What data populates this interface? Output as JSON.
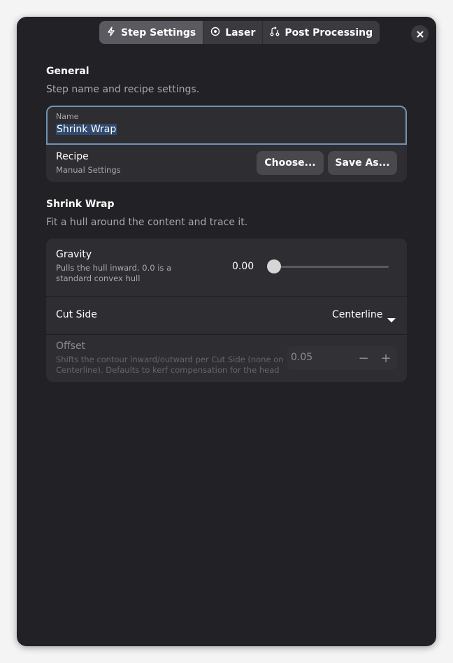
{
  "tabs": [
    {
      "label": "Step Settings",
      "icon": "lightning-icon",
      "active": true
    },
    {
      "label": "Laser",
      "icon": "laser-icon",
      "active": false
    },
    {
      "label": "Post Processing",
      "icon": "post-processing-icon",
      "active": false
    }
  ],
  "general": {
    "title": "General",
    "subtitle": "Step name and recipe settings.",
    "name_label": "Name",
    "name_value": "Shrink Wrap",
    "recipe_title": "Recipe",
    "recipe_value": "Manual Settings",
    "choose_label": "Choose...",
    "save_as_label": "Save As..."
  },
  "shrink_wrap": {
    "title": "Shrink Wrap",
    "subtitle": "Fit a hull around the content and trace it.",
    "gravity_title": "Gravity",
    "gravity_desc_1": "Pulls the hull inward. 0.0 is a",
    "gravity_desc_2": "standard convex hull",
    "gravity_value": "0.00",
    "gravity_fraction": 0.0,
    "cut_side_title": "Cut Side",
    "cut_side_value": "Centerline",
    "offset_title": "Offset",
    "offset_desc_1": "Shifts the contour inward/outward per Cut Side (none on",
    "offset_desc_2": "Centerline). Defaults to kerf compensation for the head",
    "offset_value": "0.05",
    "minus": "−",
    "plus": "+"
  }
}
